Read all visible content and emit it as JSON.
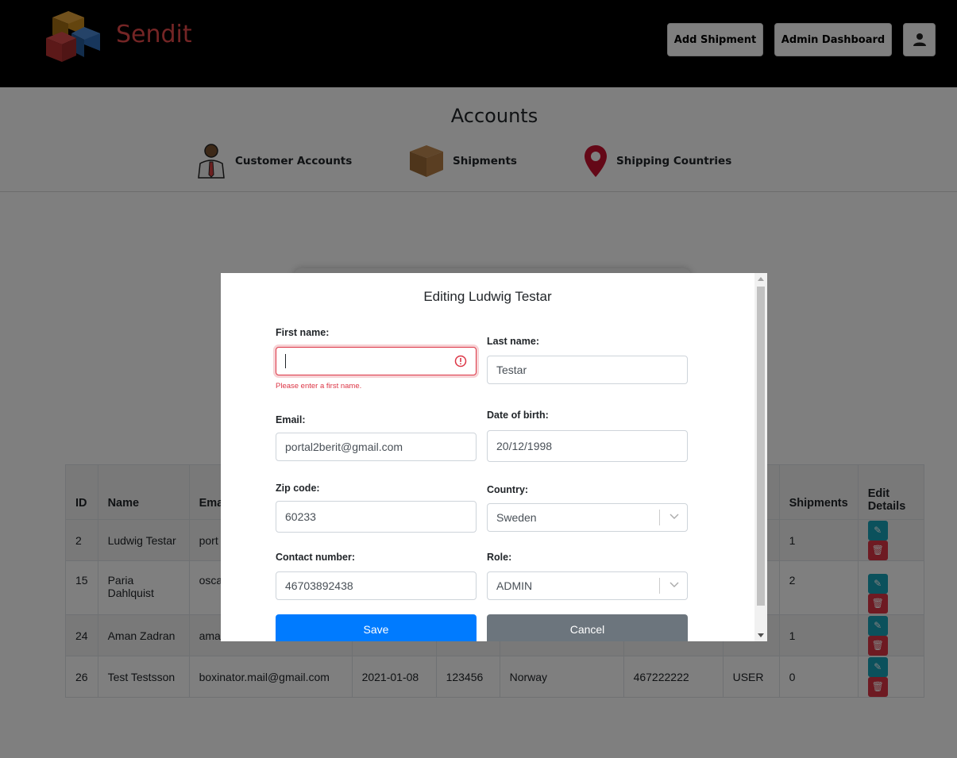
{
  "header": {
    "brand": "Sendit",
    "add_shipment": "Add Shipment",
    "admin_dashboard": "Admin Dashboard",
    "user_icon": "user-icon"
  },
  "accounts": {
    "title": "Accounts",
    "nav": {
      "customer_accounts": "Customer Accounts",
      "shipments": "Shipments",
      "shipping_countries": "Shipping Countries"
    }
  },
  "table": {
    "headers": [
      "ID",
      "Name",
      "Ema",
      "",
      "",
      "",
      "",
      "",
      "Shipments",
      "Edit Details"
    ],
    "rows": [
      {
        "id": "2",
        "name": "Ludwig Testar",
        "email": "port",
        "dob": "",
        "zip": "",
        "country": "",
        "contact": "",
        "role": "",
        "shipments": "1"
      },
      {
        "id": "15",
        "name": "Paria Dahlquist",
        "email": "osca",
        "dob": "",
        "zip": "",
        "country": "",
        "contact": "",
        "role": "",
        "shipments": "2"
      },
      {
        "id": "24",
        "name": "Aman Zadran",
        "email": "ama",
        "dob": "",
        "zip": "",
        "country": "",
        "contact": "",
        "role": "",
        "shipments": "1"
      },
      {
        "id": "26",
        "name": "Test Testsson",
        "email": "boxinator.mail@gmail.com",
        "dob": "2021-01-08",
        "zip": "123456",
        "country": "Norway",
        "contact": "467222222",
        "role": "USER",
        "shipments": "0"
      }
    ]
  },
  "modal": {
    "title": "Editing Ludwig Testar",
    "first_name": {
      "label": "First name:",
      "value": "",
      "error": "Please enter a first name."
    },
    "last_name": {
      "label": "Last name:",
      "value": "Testar"
    },
    "email": {
      "label": "Email:",
      "value": "portal2berit@gmail.com"
    },
    "dob": {
      "label": "Date of birth:",
      "value": "20/12/1998"
    },
    "zip": {
      "label": "Zip code:",
      "value": "60233"
    },
    "country": {
      "label": "Country:",
      "value": "Sweden"
    },
    "contact": {
      "label": "Contact number:",
      "value": "46703892438"
    },
    "role": {
      "label": "Role:",
      "value": "ADMIN"
    },
    "save": "Save",
    "cancel": "Cancel"
  },
  "colors": {
    "brand": "#e84a4a",
    "primary": "#007bff",
    "secondary": "#6c757d",
    "danger": "#dc3545",
    "info": "#17a2b8"
  }
}
